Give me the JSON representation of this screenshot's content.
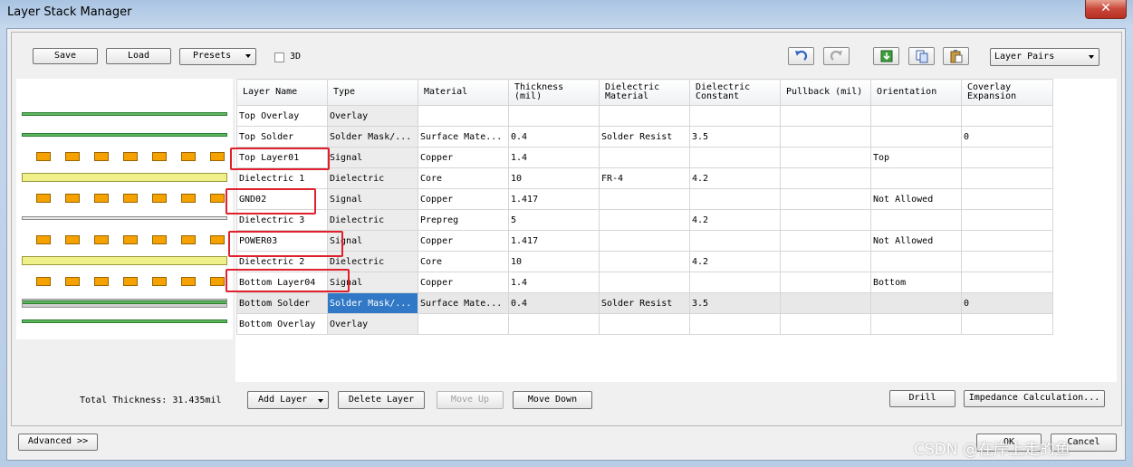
{
  "window": {
    "title": "Layer Stack Manager",
    "close_glyph": "✕"
  },
  "toolbar": {
    "save": "Save",
    "load": "Load",
    "presets": "Presets",
    "three_d": "3D",
    "layer_pairs": "Layer Pairs"
  },
  "table": {
    "headers": [
      {
        "l1": "Layer Name",
        "l2": ""
      },
      {
        "l1": "Type",
        "l2": ""
      },
      {
        "l1": "Material",
        "l2": ""
      },
      {
        "l1": "Thickness",
        "l2": "(mil)"
      },
      {
        "l1": "Dielectric",
        "l2": "Material"
      },
      {
        "l1": "Dielectric",
        "l2": "Constant"
      },
      {
        "l1": "Pullback (mil)",
        "l2": ""
      },
      {
        "l1": "Orientation",
        "l2": ""
      },
      {
        "l1": "Coverlay",
        "l2": "Expansion"
      }
    ],
    "rows": [
      [
        "Top Overlay",
        "Overlay",
        "",
        "",
        "",
        "",
        "",
        "",
        ""
      ],
      [
        "Top Solder",
        "Solder Mask/...",
        "Surface Mate...",
        "0.4",
        "Solder Resist",
        "3.5",
        "",
        "",
        "0"
      ],
      [
        "Top Layer01",
        "Signal",
        "Copper",
        "1.4",
        "",
        "",
        "",
        "Top",
        ""
      ],
      [
        "Dielectric 1",
        "Dielectric",
        "Core",
        "10",
        "FR-4",
        "4.2",
        "",
        "",
        ""
      ],
      [
        "GND02",
        "Signal",
        "Copper",
        "1.417",
        "",
        "",
        "",
        "Not Allowed",
        ""
      ],
      [
        "Dielectric 3",
        "Dielectric",
        "Prepreg",
        "5",
        "",
        "4.2",
        "",
        "",
        ""
      ],
      [
        "POWER03",
        "Signal",
        "Copper",
        "1.417",
        "",
        "",
        "",
        "Not Allowed",
        ""
      ],
      [
        "Dielectric 2",
        "Dielectric",
        "Core",
        "10",
        "",
        "4.2",
        "",
        "",
        ""
      ],
      [
        "Bottom Layer04",
        "Signal",
        "Copper",
        "1.4",
        "",
        "",
        "",
        "Bottom",
        ""
      ],
      [
        "Bottom Solder",
        "Solder Mask/...",
        "Surface Mate...",
        "0.4",
        "Solder Resist",
        "3.5",
        "",
        "",
        "0"
      ],
      [
        "Bottom Overlay",
        "Overlay",
        "",
        "",
        "",
        "",
        "",
        "",
        ""
      ]
    ],
    "selected_row": 9
  },
  "bottom": {
    "total_thickness": "Total Thickness: 31.435mil",
    "add_layer": "Add Layer",
    "delete_layer": "Delete Layer",
    "move_up": "Move Up",
    "move_down": "Move Down",
    "drill": "Drill",
    "impedance": "Impedance Calculation..."
  },
  "footer": {
    "advanced": "Advanced >>",
    "ok": "OK",
    "cancel": "Cancel"
  },
  "watermark": "CSDN @在岸上走的鱼",
  "colors": {
    "highlight": "#e0202c",
    "selection": "#3179c6",
    "pad": "#f5a200",
    "overlay_line": "#5fb85f",
    "dielectric": "#f0f08a"
  }
}
